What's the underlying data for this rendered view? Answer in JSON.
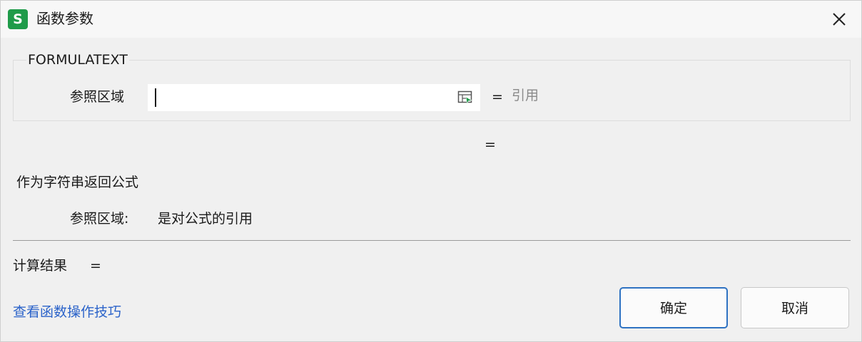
{
  "window": {
    "app_icon_text": "S",
    "title": "函数参数",
    "close_icon": "close-icon"
  },
  "function": {
    "name": "FORMULATEXT",
    "param_label": "参照区域",
    "param_value": "",
    "param_result_equals": "=",
    "param_result_value": "引用",
    "ref_icon": "collapse-dialog-icon",
    "result_equals": "="
  },
  "description": {
    "text": "作为字符串返回公式",
    "param_label": "参照区域:",
    "param_text": "是对公式的引用"
  },
  "footer": {
    "calc_label": "计算结果",
    "calc_equals": "=",
    "help_link": "查看函数操作技巧",
    "ok_label": "确定",
    "cancel_label": "取消"
  },
  "colors": {
    "app_icon_bg": "#1f9b4a",
    "link": "#2a62c9",
    "ok_border": "#2e72c2"
  }
}
